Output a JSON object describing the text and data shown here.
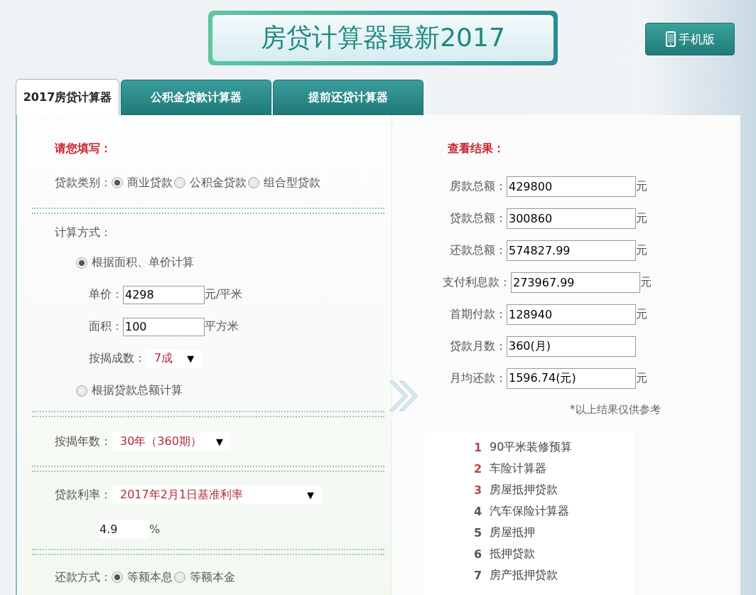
{
  "title": "房贷计算器最新2017",
  "mobile_button": "手机版",
  "tabs": [
    {
      "label": "2017房贷计算器",
      "selected": true
    },
    {
      "label": "公积金贷款计算器",
      "selected": false
    },
    {
      "label": "提前还贷计算器",
      "selected": false
    }
  ],
  "form": {
    "heading": "请您填写：",
    "loan_type": {
      "label": "贷款类别：",
      "options": [
        {
          "label": "商业贷款",
          "selected": true
        },
        {
          "label": "公积金贷款",
          "selected": false
        },
        {
          "label": "组合型贷款",
          "selected": false
        }
      ]
    },
    "method": {
      "label": "计算方式：",
      "options": [
        {
          "label": "根据面积、单价计算",
          "selected": true
        },
        {
          "label": "根据贷款总额计算",
          "selected": false
        }
      ]
    },
    "price": {
      "label": "单价：",
      "value": "4298",
      "unit": "元/平米"
    },
    "area": {
      "label": "面积：",
      "value": "100",
      "unit": "平方米"
    },
    "ratio": {
      "label": "按揭成数：",
      "value": "7成",
      "arrow": "▼"
    },
    "years": {
      "label": "按揭年数：",
      "value": "30年（360期）",
      "arrow": "▼"
    },
    "rate": {
      "label": "贷款利率：",
      "value": "2017年2月1日基准利率",
      "arrow": "▼"
    },
    "rate_value": {
      "value": "4.9",
      "unit": "%"
    },
    "repayment": {
      "label": "还款方式：",
      "options": [
        {
          "label": "等额本息",
          "selected": true
        },
        {
          "label": "等额本金",
          "selected": false
        }
      ]
    }
  },
  "results": {
    "heading": "查看结果：",
    "rows": [
      {
        "label": "房款总额：",
        "value": "429800",
        "unit": "元"
      },
      {
        "label": "贷款总额：",
        "value": "300860",
        "unit": "元"
      },
      {
        "label": "还款总额：",
        "value": "574827.99",
        "unit": "元"
      },
      {
        "label": "支付利息款：",
        "value": "273967.99",
        "unit": "元"
      },
      {
        "label": "首期付款：",
        "value": "128940",
        "unit": "元"
      },
      {
        "label": "贷款月数：",
        "value": "360(月)"
      },
      {
        "label": "月均还款：",
        "value": "1596.74(元)",
        "unit": "元"
      }
    ],
    "note": "*以上结果仅供参考"
  },
  "ranking": [
    {
      "rank": "1",
      "label": "90平米装修预算",
      "color": "#b5454a"
    },
    {
      "rank": "2",
      "label": "车险计算器",
      "color": "#b5454a"
    },
    {
      "rank": "3",
      "label": "房屋抵押贷款",
      "color": "#b5454a"
    },
    {
      "rank": "4",
      "label": "汽车保险计算器",
      "color": "#555555"
    },
    {
      "rank": "5",
      "label": "房屋抵押",
      "color": "#555555"
    },
    {
      "rank": "6",
      "label": "抵押贷款",
      "color": "#555555"
    },
    {
      "rank": "7",
      "label": "房产抵押贷款",
      "color": "#555555"
    }
  ]
}
